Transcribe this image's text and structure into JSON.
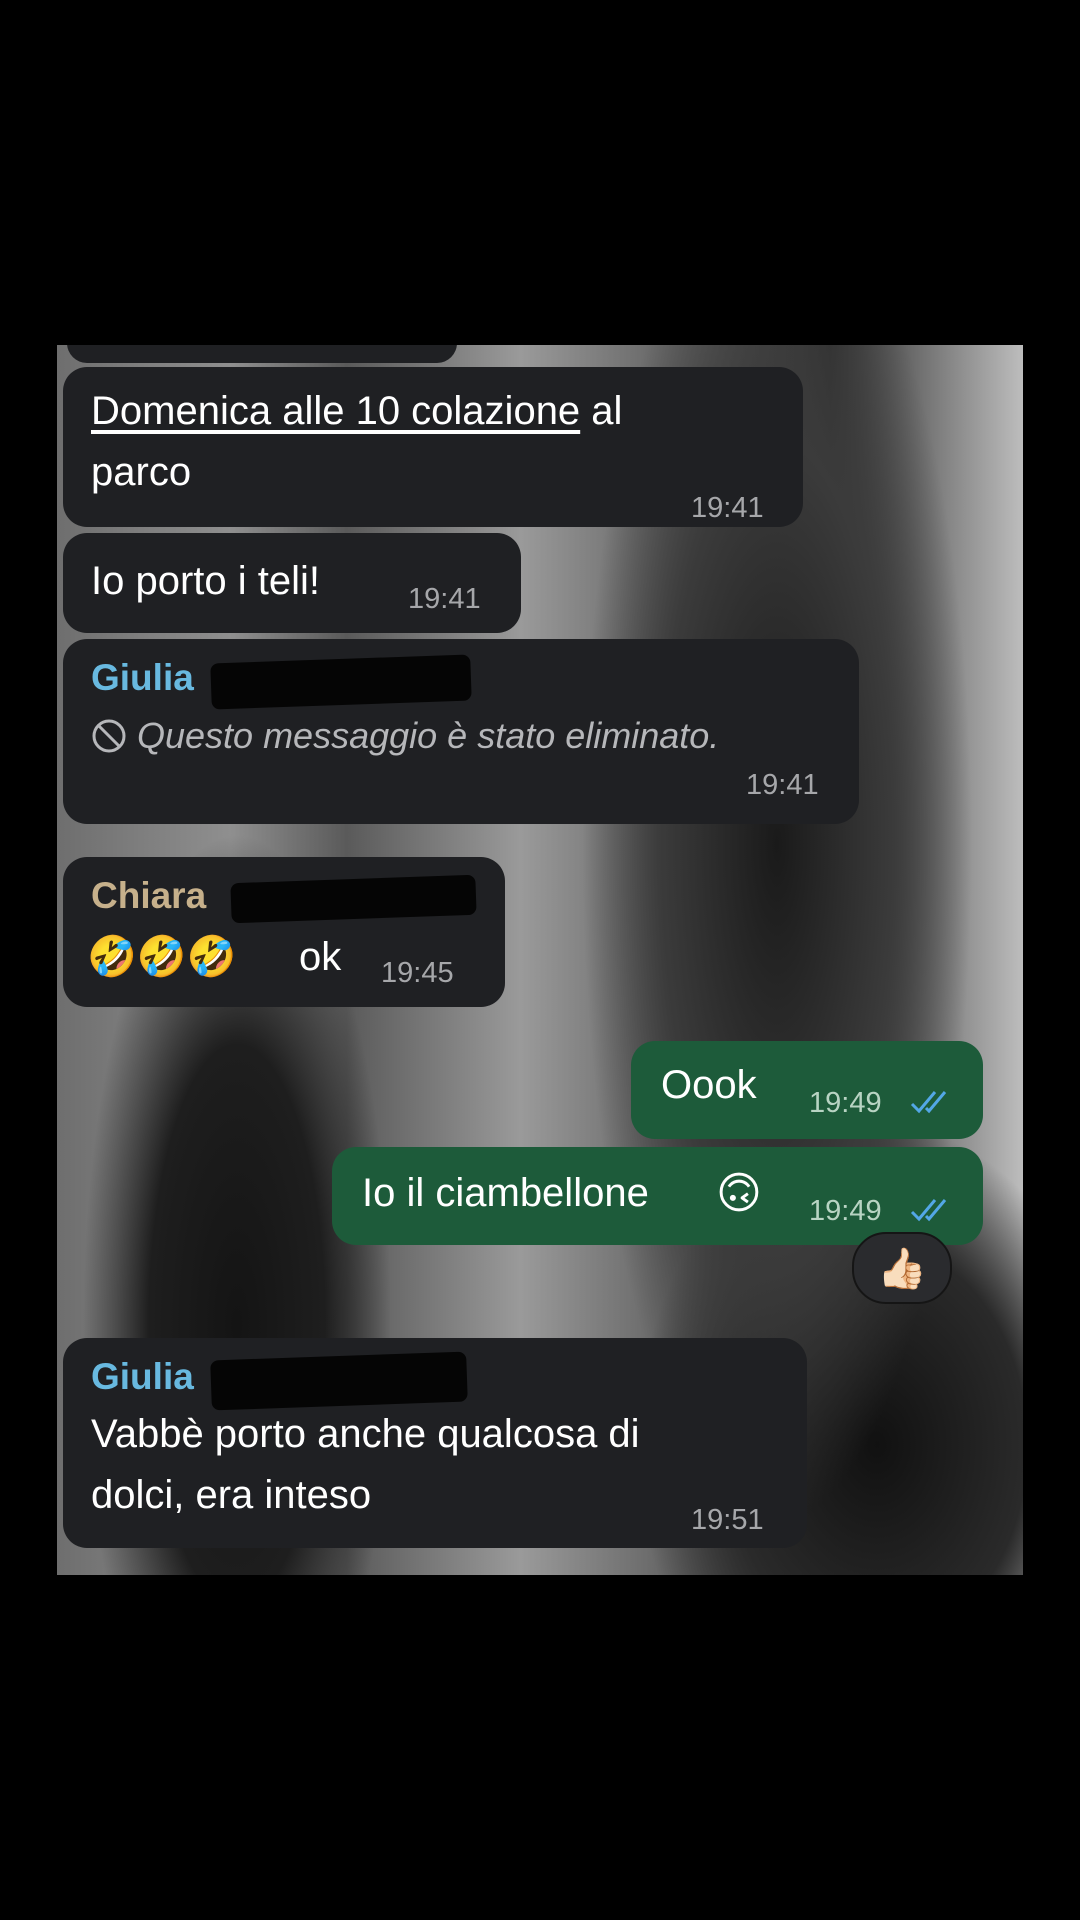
{
  "messages": [
    {
      "text_link": "Domenica alle 10 colazione",
      "text_rest": " al",
      "text_line2": "parco",
      "time": "19:41"
    },
    {
      "text": "Io porto i teli!",
      "time": "19:41"
    },
    {
      "sender": "Giulia",
      "deleted_text": "Questo messaggio è stato eliminato.",
      "time": "19:41"
    },
    {
      "sender": "Chiara",
      "emoji": "🤣🤣🤣",
      "text": "ok",
      "time": "19:45"
    },
    {
      "text": "Oook",
      "time": "19:49"
    },
    {
      "text": "Io il ciambellone",
      "emoji": "🙃",
      "time": "19:49",
      "reaction": "👍🏻"
    },
    {
      "sender": "Giulia",
      "text_line1": "Vabbè porto anche qualcosa di",
      "text_line2": "dolci, era inteso",
      "time": "19:51"
    }
  ],
  "colors": {
    "incoming_bubble": "#1f2023",
    "outgoing_bubble": "#1d5b3a",
    "sender_giulia": "#68b9e0",
    "sender_chiara": "#c6b08b",
    "read_ticks": "#53a7e6"
  },
  "icons": {
    "deleted": "block-icon",
    "read_receipt": "double-check-icon"
  }
}
